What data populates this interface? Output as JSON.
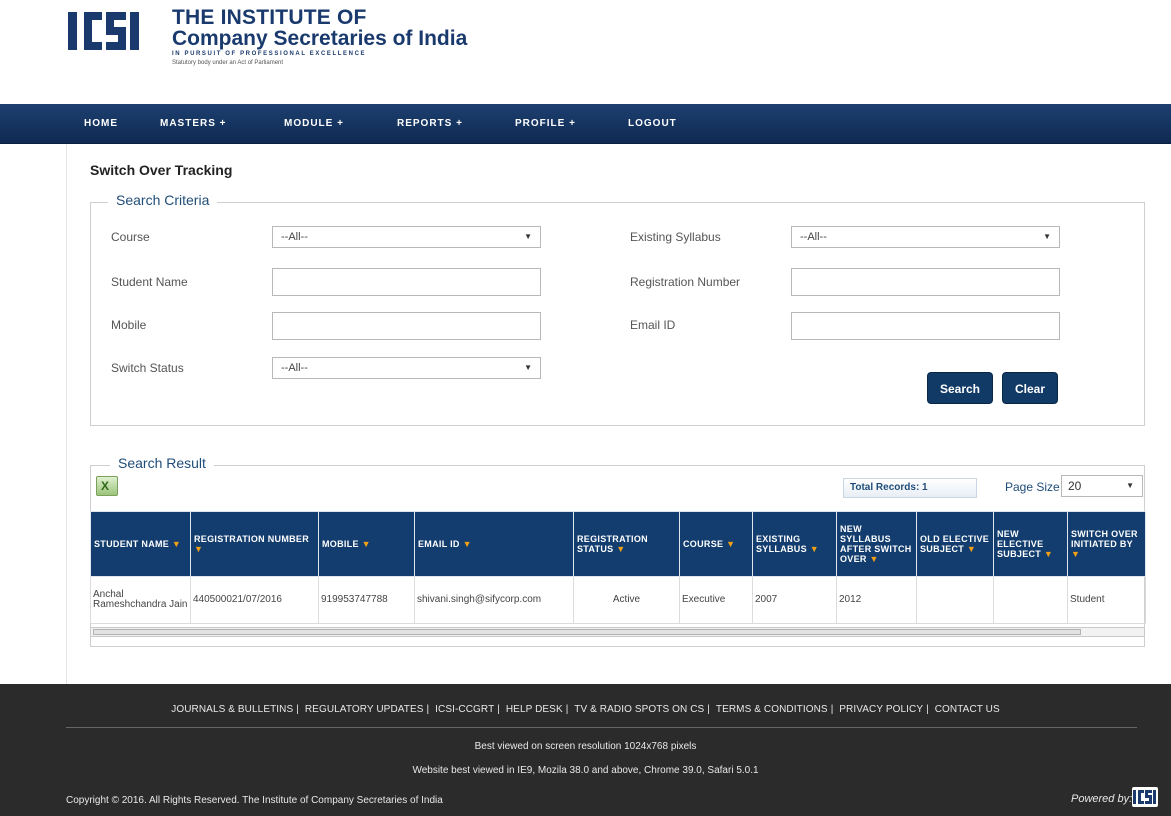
{
  "header": {
    "org_line1": "THE INSTITUTE OF",
    "org_line2": "Company Secretaries of India",
    "tagline": "IN PURSUIT OF PROFESSIONAL EXCELLENCE",
    "subtag": "Statutory body under an Act of Parliament"
  },
  "nav": {
    "items": [
      "HOME",
      "MASTERS +",
      "MODULE +",
      "REPORTS +",
      "PROFILE +",
      "LOGOUT"
    ]
  },
  "page": {
    "title": "Switch Over Tracking"
  },
  "search": {
    "legend": "Search Criteria",
    "course_label": "Course",
    "course_value": "--All--",
    "existing_syllabus_label": "Existing Syllabus",
    "existing_syllabus_value": "--All--",
    "student_name_label": "Student Name",
    "student_name_value": "",
    "registration_number_label": "Registration Number",
    "registration_number_value": "",
    "mobile_label": "Mobile",
    "mobile_value": "",
    "email_label": "Email ID",
    "email_value": "",
    "switch_status_label": "Switch Status",
    "switch_status_value": "--All--",
    "search_button": "Search",
    "clear_button": "Clear"
  },
  "results": {
    "legend": "Search Result",
    "excel_icon": "excel-export-icon",
    "total_records": "Total Records: 1",
    "page_size_label": "Page Size",
    "page_size_value": "20",
    "columns": [
      "STUDENT NAME",
      "REGISTRATION NUMBER",
      "MOBILE",
      "EMAIL ID",
      "REGISTRATION STATUS",
      "COURSE",
      "EXISTING SYLLABUS",
      "NEW SYLLABUS AFTER SWITCH OVER",
      "OLD ELECTIVE SUBJECT",
      "NEW ELECTIVE SUBJECT",
      "SWITCH OVER INITIATED BY"
    ],
    "rows": [
      {
        "student_name": "Anchal Rameshchandra Jain",
        "registration_number": "440500021/07/2016",
        "mobile": "919953747788",
        "email": "shivani.singh@sifycorp.com",
        "registration_status": "Active",
        "course": "Executive",
        "existing_syllabus": "2007",
        "new_syllabus": "2012",
        "old_elective": "",
        "new_elective": "",
        "initiated_by": "Student"
      }
    ]
  },
  "footer": {
    "links": [
      "JOURNALS & BULLETINS",
      "REGULATORY UPDATES",
      "ICSI-CCGRT",
      "HELP DESK",
      "TV & RADIO SPOTS ON CS",
      "TERMS & CONDITIONS",
      "PRIVACY POLICY",
      "CONTACT US"
    ],
    "note1": "Best viewed on screen resolution 1024x768 pixels",
    "note2": "Website best viewed in IE9, Mozila 38.0 and above, Chrome 39.0, Safari 5.0.1",
    "copyright": "Copyright © 2016. All Rights Reserved. The Institute of Company Secretaries of India",
    "powered_by": "Powered by:"
  },
  "colors": {
    "nav_bg": "#123a66",
    "table_header_bg": "#123d6e",
    "footer_bg": "#2b2b2b",
    "legend_text": "#1f4d7a",
    "sort_marker": "#f0a017"
  }
}
